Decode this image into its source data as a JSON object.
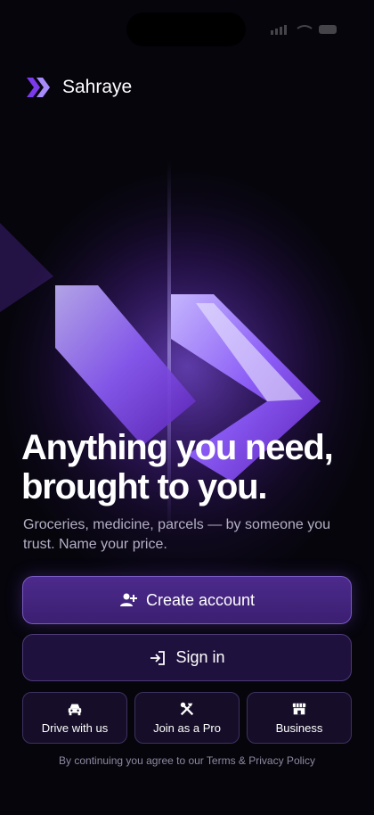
{
  "app": {
    "name": "Sahraye",
    "brand_color": "#7c3aed"
  },
  "hero": {
    "headline_line1": "Anything you need,",
    "headline_line2": "brought to you.",
    "subtitle": "Groceries, medicine, parcels — by someone you trust. Name your price."
  },
  "actions": {
    "create_account": {
      "label": "Create account",
      "icon": "person-add-icon"
    },
    "sign_in": {
      "label": "Sign in",
      "icon": "sign-in-icon"
    }
  },
  "options": [
    {
      "label": "Drive with us",
      "icon": "car-icon"
    },
    {
      "label": "Join as a Pro",
      "icon": "tools-icon"
    },
    {
      "label": "Business",
      "icon": "storefront-icon"
    }
  ],
  "legal": {
    "text": "By continuing you agree to our Terms & Privacy Policy"
  }
}
